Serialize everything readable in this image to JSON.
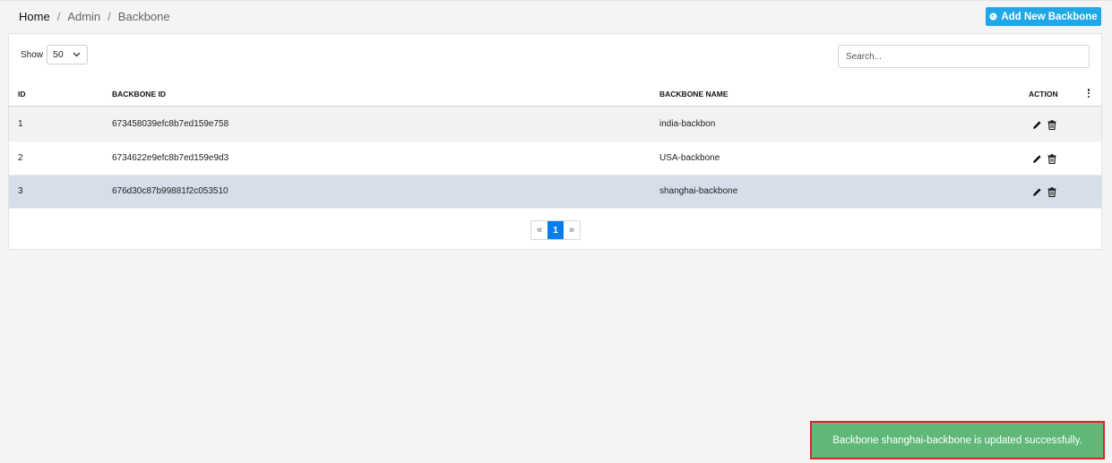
{
  "breadcrumb": {
    "home": "Home",
    "separator": "/",
    "admin": "Admin",
    "current": "Backbone"
  },
  "header": {
    "add_button_label": "Add New Backbone",
    "add_button_icon": "globe-icon",
    "accent_color": "#1fa8e8"
  },
  "controls": {
    "show_label": "Show",
    "page_size": "50",
    "search_placeholder": "Search..."
  },
  "table": {
    "columns": [
      "ID",
      "BACKBONE ID",
      "BACKBONE NAME",
      "ACTION"
    ],
    "rows": [
      {
        "id": "1",
        "backbone_id": "673458039efc8b7ed159e758",
        "name": "india-backbon"
      },
      {
        "id": "2",
        "backbone_id": "6734622e9efc8b7ed159e9d3",
        "name": "USA-backbone"
      },
      {
        "id": "3",
        "backbone_id": "676d30c87b99881f2c053510",
        "name": "shanghai-backbone"
      }
    ],
    "row_actions": [
      "edit-icon",
      "trash-icon"
    ],
    "highlighted_row_color": "#d6dfe9"
  },
  "pagination": {
    "prev": "«",
    "current_page": "1",
    "next": "»",
    "active_color": "#0b7dea"
  },
  "toast": {
    "message": "Backbone shanghai-backbone is updated successfully.",
    "background": "#5fb878",
    "border_color": "#d8252a"
  }
}
